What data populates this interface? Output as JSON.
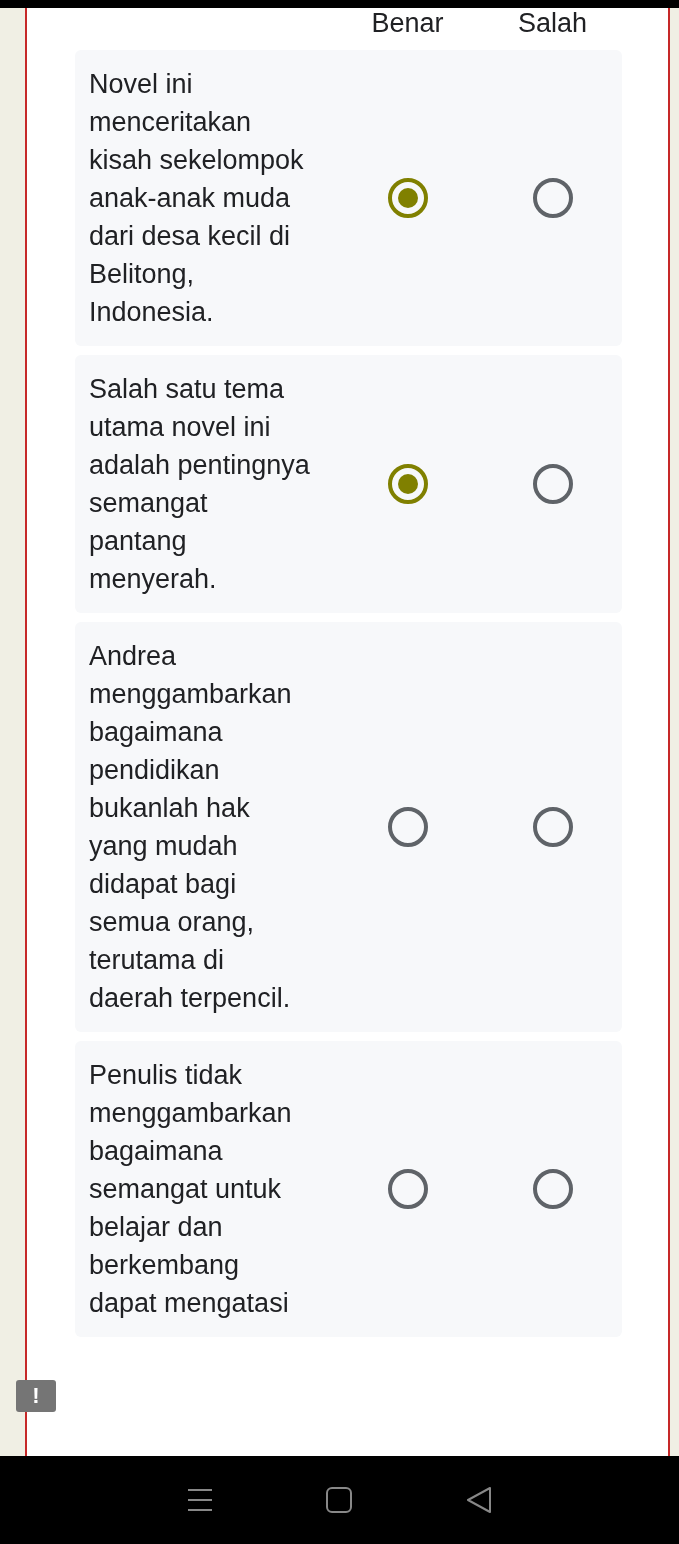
{
  "columns": [
    "Benar",
    "Salah"
  ],
  "rows": [
    {
      "statement": "Novel ini menceritakan kisah sekelompok anak-anak muda dari desa kecil di Belitong, Indonesia.",
      "options": [
        {
          "selected": true
        },
        {
          "selected": false
        }
      ]
    },
    {
      "statement": "Salah satu tema utama novel ini adalah pentingnya semangat pantang menyerah.",
      "options": [
        {
          "selected": true
        },
        {
          "selected": false
        }
      ]
    },
    {
      "statement": "Andrea menggambarkan bagaimana pendidikan bukanlah hak yang mudah didapat bagi semua orang, terutama di daerah terpencil.",
      "options": [
        {
          "selected": false
        },
        {
          "selected": false
        }
      ]
    },
    {
      "statement": "Penulis tidak menggambarkan bagaimana semangat untuk belajar dan berkembang dapat mengatasi",
      "options": [
        {
          "selected": false
        },
        {
          "selected": false
        }
      ]
    }
  ],
  "feedback_badge": "!"
}
